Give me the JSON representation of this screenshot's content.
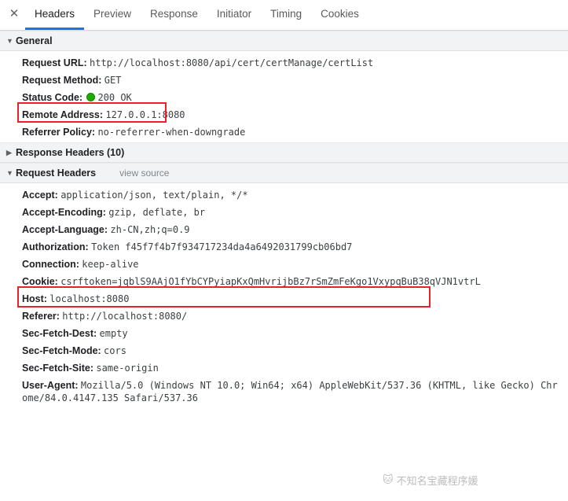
{
  "tabbar": {
    "close_icon": "close-icon",
    "close_glyph": "✕",
    "tabs": [
      {
        "label": "Headers",
        "active": true
      },
      {
        "label": "Preview",
        "active": false
      },
      {
        "label": "Response",
        "active": false
      },
      {
        "label": "Initiator",
        "active": false
      },
      {
        "label": "Timing",
        "active": false
      },
      {
        "label": "Cookies",
        "active": false
      }
    ],
    "active_underline_color": "#1a73e8"
  },
  "general": {
    "title": "General",
    "expanded": true,
    "triangle": "▼",
    "rows": [
      {
        "key": "Request URL:",
        "value": "http://localhost:8080/api/cert/certManage/certList"
      },
      {
        "key": "Request Method:",
        "value": "GET"
      },
      {
        "key": "Status Code:",
        "value": "200  OK",
        "status_dot": true,
        "status_color": "#1faa00"
      },
      {
        "key": "Remote Address:",
        "value": "127.0.0.1:8080"
      },
      {
        "key": "Referrer Policy:",
        "value": "no-referrer-when-downgrade"
      }
    ]
  },
  "response_headers": {
    "title": "Response Headers (10)",
    "count": "10",
    "expanded": false,
    "triangle": "▶"
  },
  "request_headers": {
    "title": "Request Headers",
    "expanded": true,
    "triangle": "▼",
    "view_source": "view source",
    "rows": [
      {
        "key": "Accept:",
        "value": "application/json, text/plain, */*"
      },
      {
        "key": "Accept-Encoding:",
        "value": "gzip, deflate, br"
      },
      {
        "key": "Accept-Language:",
        "value": "zh-CN,zh;q=0.9"
      },
      {
        "key": "Authorization:",
        "value": "Token f45f7f4b7f934717234da4a6492031799cb06bd7"
      },
      {
        "key": "Connection:",
        "value": "keep-alive"
      },
      {
        "key": "Cookie:",
        "value": "csrftoken=jqblS9AAjO1fYbCYPyiapKxQmHvrijbBz7rSmZmFeKgo1VxypqBuB38qVJN1vtrL"
      },
      {
        "key": "Host:",
        "value": "localhost:8080"
      },
      {
        "key": "Referer:",
        "value": "http://localhost:8080/"
      },
      {
        "key": "Sec-Fetch-Dest:",
        "value": "empty"
      },
      {
        "key": "Sec-Fetch-Mode:",
        "value": "cors"
      },
      {
        "key": "Sec-Fetch-Site:",
        "value": "same-origin"
      },
      {
        "key": "User-Agent:",
        "value": "Mozilla/5.0 (Windows NT 10.0; Win64; x64) AppleWebKit/537.36 (KHTML, like Gecko) Chrome/84.0.4147.135 Safari/537.36"
      }
    ]
  },
  "annotations": {
    "box_color": "#e8222a",
    "boxes": [
      "status-code-row",
      "authorization-row"
    ]
  },
  "watermark": {
    "text": "不知名宝藏程序媛",
    "icon": "🐱"
  }
}
